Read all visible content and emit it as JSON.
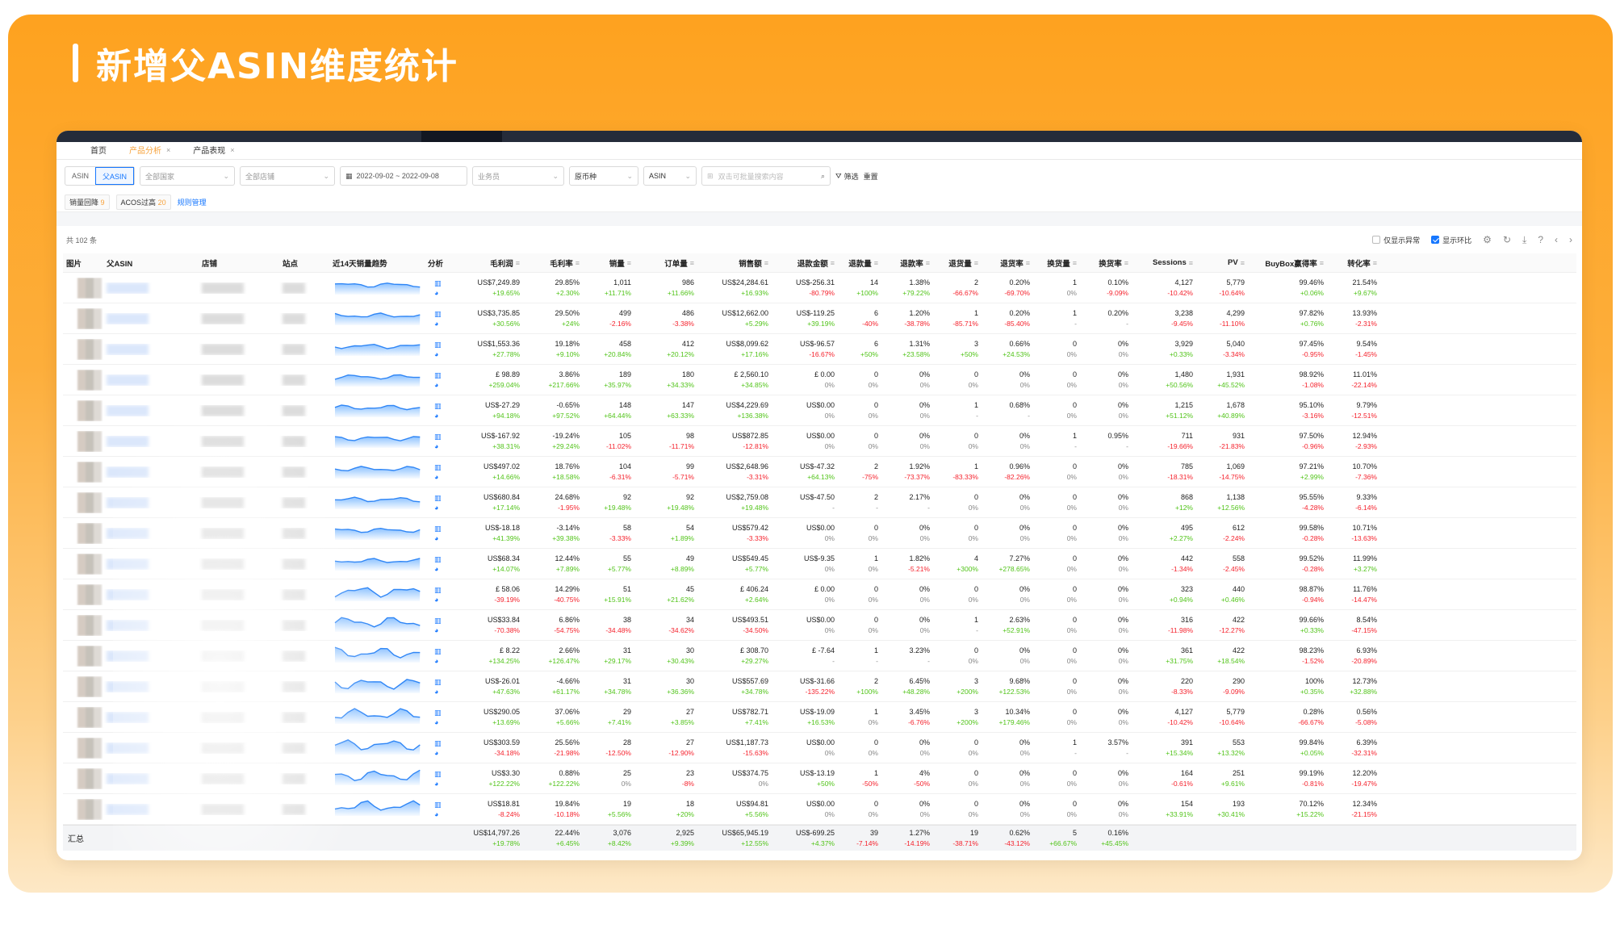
{
  "banner": {
    "title": "新增父ASIN维度统计"
  },
  "tabs": [
    {
      "label": "首页",
      "closable": false,
      "active": false
    },
    {
      "label": "产品分析",
      "closable": true,
      "active": true
    },
    {
      "label": "产品表现",
      "closable": true,
      "active": false
    }
  ],
  "filters": {
    "seg": [
      "ASIN",
      "父ASIN"
    ],
    "country": "全部国家",
    "shop": "全部店铺",
    "date_range": "2022-09-02 ~ 2022-09-08",
    "salesperson": "业务员",
    "currency": "原币种",
    "search_type": "ASIN",
    "search_placeholder": "双击可批量搜索内容",
    "filter_label": "筛选",
    "reset_label": "重置"
  },
  "chips": [
    {
      "label": "销量回降",
      "count": "9"
    },
    {
      "label": "ACOS过高",
      "count": "20"
    }
  ],
  "rule_link": "规则管理",
  "toolbar": {
    "total": "共 102 条",
    "only_abnormal": "仅显示异常",
    "show_ring": "显示环比"
  },
  "columns": {
    "img": "图片",
    "parent": "父ASIN",
    "shop": "店铺",
    "site": "站点",
    "trend": "近14天销量趋势",
    "analysis": "分析",
    "profit": "毛利润",
    "margin": "毛利率",
    "sales": "销量",
    "orders": "订单量",
    "revenue": "销售额",
    "refund_amt": "退款金额",
    "refund_qty": "退款量",
    "refund_rate": "退款率",
    "return_qty": "退货量",
    "return_rate": "退货率",
    "exch_qty": "换货量",
    "exch_rate": "换货率",
    "sessions": "Sessions",
    "pv": "PV",
    "buybox": "BuyBox赢得率",
    "cvr": "转化率"
  },
  "rows": [
    [
      "US$7,249.89",
      "+19.65%",
      "29.85%",
      "+2.30%",
      "1,011",
      "+11.71%",
      "986",
      "+11.66%",
      "US$24,284.61",
      "+16.93%",
      "US$-256.31",
      "-80.79%",
      "14",
      "+100%",
      "1.38%",
      "+79.22%",
      "2",
      "-66.67%",
      "0.20%",
      "-69.70%",
      "1",
      "0%",
      "0.10%",
      "-9.09%",
      "4,127",
      "-10.42%",
      "5,779",
      "-10.64%",
      "99.46%",
      "+0.06%",
      "21.54%",
      "+9.67%"
    ],
    [
      "US$3,735.85",
      "+30.56%",
      "29.50%",
      "+24%",
      "499",
      "-2.16%",
      "486",
      "-3.38%",
      "US$12,662.00",
      "+5.29%",
      "US$-119.25",
      "+39.19%",
      "6",
      "-40%",
      "1.20%",
      "-38.78%",
      "1",
      "-85.71%",
      "0.20%",
      "-85.40%",
      "1",
      "-",
      "0.20%",
      "-",
      "3,238",
      "-9.45%",
      "4,299",
      "-11.10%",
      "97.82%",
      "+0.76%",
      "13.93%",
      "-2.31%"
    ],
    [
      "US$1,553.36",
      "+27.78%",
      "19.18%",
      "+9.10%",
      "458",
      "+20.84%",
      "412",
      "+20.12%",
      "US$8,099.62",
      "+17.16%",
      "US$-96.57",
      "-16.67%",
      "6",
      "+50%",
      "1.31%",
      "+23.58%",
      "3",
      "+50%",
      "0.66%",
      "+24.53%",
      "0",
      "0%",
      "0%",
      "0%",
      "3,929",
      "+0.33%",
      "5,040",
      "-3.34%",
      "97.45%",
      "-0.95%",
      "9.54%",
      "-1.45%"
    ],
    [
      "£ 98.89",
      "+259.04%",
      "3.86%",
      "+217.66%",
      "189",
      "+35.97%",
      "180",
      "+34.33%",
      "£ 2,560.10",
      "+34.85%",
      "£ 0.00",
      "0%",
      "0",
      "0%",
      "0%",
      "0%",
      "0",
      "0%",
      "0%",
      "0%",
      "0",
      "0%",
      "0%",
      "0%",
      "1,480",
      "+50.56%",
      "1,931",
      "+45.52%",
      "98.92%",
      "-1.08%",
      "11.01%",
      "-22.14%"
    ],
    [
      "US$-27.29",
      "+94.18%",
      "-0.65%",
      "+97.52%",
      "148",
      "+64.44%",
      "147",
      "+63.33%",
      "US$4,229.69",
      "+136.38%",
      "US$0.00",
      "0%",
      "0",
      "0%",
      "0%",
      "0%",
      "1",
      "-",
      "0.68%",
      "-",
      "0",
      "0%",
      "0%",
      "0%",
      "1,215",
      "+51.12%",
      "1,678",
      "+40.89%",
      "95.10%",
      "-3.16%",
      "9.79%",
      "-12.51%"
    ],
    [
      "US$-167.92",
      "+38.31%",
      "-19.24%",
      "+29.24%",
      "105",
      "-11.02%",
      "98",
      "-11.71%",
      "US$872.85",
      "-12.81%",
      "US$0.00",
      "0%",
      "0",
      "0%",
      "0%",
      "0%",
      "0",
      "0%",
      "0%",
      "0%",
      "1",
      "-",
      "0.95%",
      "-",
      "711",
      "-19.66%",
      "931",
      "-21.83%",
      "97.50%",
      "-0.96%",
      "12.94%",
      "-2.93%"
    ],
    [
      "US$497.02",
      "+14.66%",
      "18.76%",
      "+18.58%",
      "104",
      "-6.31%",
      "99",
      "-5.71%",
      "US$2,648.96",
      "-3.31%",
      "US$-47.32",
      "+64.13%",
      "2",
      "-75%",
      "1.92%",
      "-73.37%",
      "1",
      "-83.33%",
      "0.96%",
      "-82.26%",
      "0",
      "0%",
      "0%",
      "0%",
      "785",
      "-18.31%",
      "1,069",
      "-14.75%",
      "97.21%",
      "+2.99%",
      "10.70%",
      "-7.36%"
    ],
    [
      "US$680.84",
      "+17.14%",
      "24.68%",
      "-1.95%",
      "92",
      "+19.48%",
      "92",
      "+19.48%",
      "US$2,759.08",
      "+19.48%",
      "US$-47.50",
      "-",
      "2",
      "-",
      "2.17%",
      "-",
      "0",
      "0%",
      "0%",
      "0%",
      "0",
      "0%",
      "0%",
      "0%",
      "868",
      "+12%",
      "1,138",
      "+12.56%",
      "95.55%",
      "-4.28%",
      "9.33%",
      "-6.14%"
    ],
    [
      "US$-18.18",
      "+41.39%",
      "-3.14%",
      "+39.38%",
      "58",
      "-3.33%",
      "54",
      "+1.89%",
      "US$579.42",
      "-3.33%",
      "US$0.00",
      "0%",
      "0",
      "0%",
      "0%",
      "0%",
      "0",
      "0%",
      "0%",
      "0%",
      "0",
      "0%",
      "0%",
      "0%",
      "495",
      "+2.27%",
      "612",
      "-2.24%",
      "99.58%",
      "-0.28%",
      "10.71%",
      "-13.63%"
    ],
    [
      "US$68.34",
      "+14.07%",
      "12.44%",
      "+7.89%",
      "55",
      "+5.77%",
      "49",
      "+8.89%",
      "US$549.45",
      "+5.77%",
      "US$-9.35",
      "0%",
      "1",
      "0%",
      "1.82%",
      "-5.21%",
      "4",
      "+300%",
      "7.27%",
      "+278.65%",
      "0",
      "0%",
      "0%",
      "0%",
      "442",
      "-1.34%",
      "558",
      "-2.45%",
      "99.52%",
      "-0.28%",
      "11.99%",
      "+3.27%"
    ],
    [
      "£ 58.06",
      "-39.19%",
      "14.29%",
      "-40.75%",
      "51",
      "+15.91%",
      "45",
      "+21.62%",
      "£ 406.24",
      "+2.64%",
      "£ 0.00",
      "0%",
      "0",
      "0%",
      "0%",
      "0%",
      "0",
      "0%",
      "0%",
      "0%",
      "0",
      "0%",
      "0%",
      "0%",
      "323",
      "+0.94%",
      "440",
      "+0.46%",
      "98.87%",
      "-0.94%",
      "11.76%",
      "-14.47%"
    ],
    [
      "US$33.84",
      "-70.38%",
      "6.86%",
      "-54.75%",
      "38",
      "-34.48%",
      "34",
      "-34.62%",
      "US$493.51",
      "-34.50%",
      "US$0.00",
      "0%",
      "0",
      "0%",
      "0%",
      "0%",
      "1",
      "-",
      "2.63%",
      "+52.91%",
      "0",
      "0%",
      "0%",
      "0%",
      "316",
      "-11.98%",
      "422",
      "-12.27%",
      "99.66%",
      "+0.33%",
      "8.54%",
      "-47.15%"
    ],
    [
      "£ 8.22",
      "+134.25%",
      "2.66%",
      "+126.47%",
      "31",
      "+29.17%",
      "30",
      "+30.43%",
      "£ 308.70",
      "+29.27%",
      "£ -7.64",
      "-",
      "1",
      "-",
      "3.23%",
      "-",
      "0",
      "0%",
      "0%",
      "0%",
      "0",
      "0%",
      "0%",
      "0%",
      "361",
      "+31.75%",
      "422",
      "+18.54%",
      "98.23%",
      "-1.52%",
      "6.93%",
      "-20.89%"
    ],
    [
      "US$-26.01",
      "+47.63%",
      "-4.66%",
      "+61.17%",
      "31",
      "+34.78%",
      "30",
      "+36.36%",
      "US$557.69",
      "+34.78%",
      "US$-31.66",
      "-135.22%",
      "2",
      "+100%",
      "6.45%",
      "+48.28%",
      "3",
      "+200%",
      "9.68%",
      "+122.53%",
      "0",
      "0%",
      "0%",
      "0%",
      "220",
      "-8.33%",
      "290",
      "-9.09%",
      "100%",
      "+0.35%",
      "12.73%",
      "+32.88%"
    ],
    [
      "US$290.05",
      "+13.69%",
      "37.06%",
      "+5.66%",
      "29",
      "+7.41%",
      "27",
      "+3.85%",
      "US$782.71",
      "+7.41%",
      "US$-19.09",
      "+16.53%",
      "1",
      "0%",
      "3.45%",
      "-6.76%",
      "3",
      "+200%",
      "10.34%",
      "+179.46%",
      "0",
      "0%",
      "0%",
      "0%",
      "4,127",
      "-10.42%",
      "5,779",
      "-10.64%",
      "0.28%",
      "-66.67%",
      "0.56%",
      "-5.08%"
    ],
    [
      "US$303.59",
      "-34.18%",
      "25.56%",
      "-21.98%",
      "28",
      "-12.50%",
      "27",
      "-12.90%",
      "US$1,187.73",
      "-15.63%",
      "US$0.00",
      "0%",
      "0",
      "0%",
      "0%",
      "0%",
      "0",
      "0%",
      "0%",
      "0%",
      "1",
      "-",
      "3.57%",
      "-",
      "391",
      "+15.34%",
      "553",
      "+13.32%",
      "99.84%",
      "+0.05%",
      "6.39%",
      "-32.31%"
    ],
    [
      "US$3.30",
      "+122.22%",
      "0.88%",
      "+122.22%",
      "25",
      "0%",
      "23",
      "-8%",
      "US$374.75",
      "0%",
      "US$-13.19",
      "+50%",
      "1",
      "-50%",
      "4%",
      "-50%",
      "0",
      "0%",
      "0%",
      "0%",
      "0",
      "0%",
      "0%",
      "0%",
      "164",
      "-0.61%",
      "251",
      "+9.61%",
      "99.19%",
      "-0.81%",
      "12.20%",
      "-19.47%"
    ],
    [
      "US$18.81",
      "-8.24%",
      "19.84%",
      "-10.18%",
      "19",
      "+5.56%",
      "18",
      "+20%",
      "US$94.81",
      "+5.56%",
      "US$0.00",
      "0%",
      "0",
      "0%",
      "0%",
      "0%",
      "0",
      "0%",
      "0%",
      "0%",
      "0",
      "0%",
      "0%",
      "0%",
      "154",
      "+33.91%",
      "193",
      "+30.41%",
      "70.12%",
      "+15.22%",
      "12.34%",
      "-21.15%"
    ]
  ],
  "footer": {
    "label": "汇总",
    "values": [
      "US$14,797.26",
      "+19.78%",
      "22.44%",
      "+6.45%",
      "3,076",
      "+8.42%",
      "2,925",
      "+9.39%",
      "US$65,945.19",
      "+12.55%",
      "US$-699.25",
      "+4.37%",
      "39",
      "-7.14%",
      "1.27%",
      "-14.19%",
      "19",
      "-38.71%",
      "0.62%",
      "-43.12%",
      "5",
      "+66.67%",
      "0.16%",
      "+45.45%"
    ]
  },
  "colors": {
    "banner": "#fea21f",
    "accent": "#f7a23b",
    "link": "#1677ff",
    "positive": "#52c41a",
    "negative": "#f5222d"
  }
}
